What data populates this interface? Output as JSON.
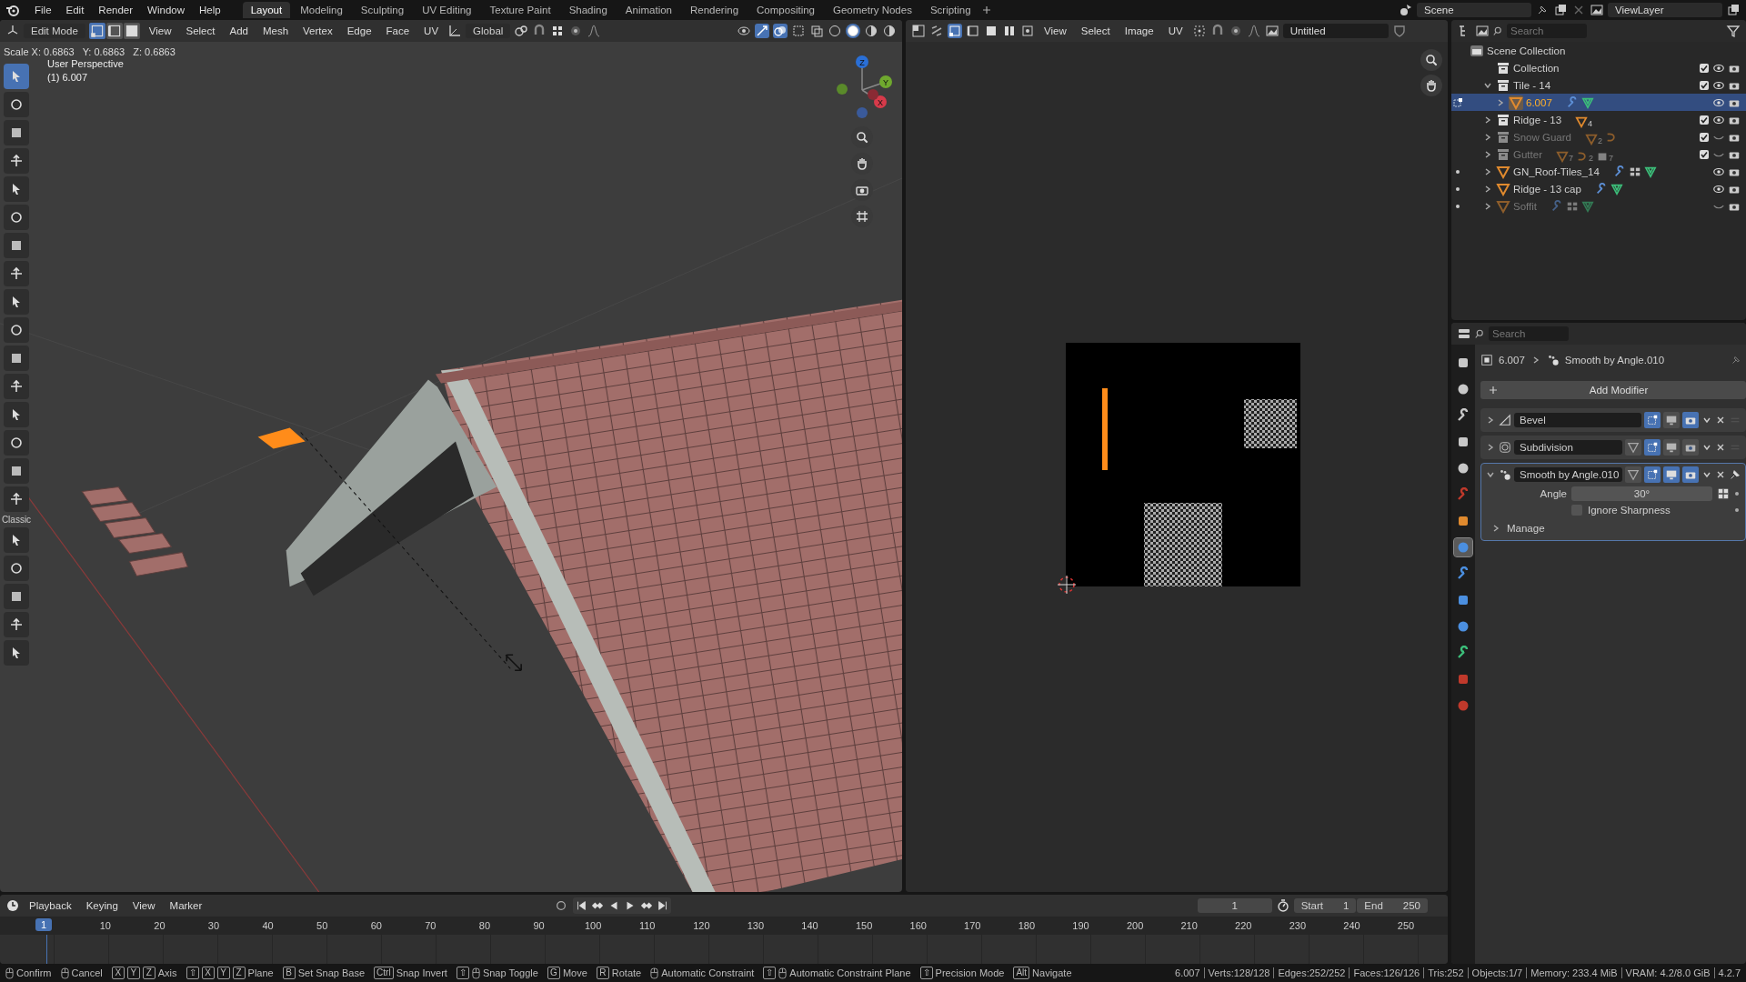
{
  "menu": [
    "File",
    "Edit",
    "Render",
    "Window",
    "Help"
  ],
  "workspaces": [
    {
      "label": "Layout",
      "selected": true
    },
    {
      "label": "Modeling",
      "selected": false
    },
    {
      "label": "Sculpting",
      "selected": false
    },
    {
      "label": "UV Editing",
      "selected": false
    },
    {
      "label": "Texture Paint",
      "selected": false
    },
    {
      "label": "Shading",
      "selected": false
    },
    {
      "label": "Animation",
      "selected": false
    },
    {
      "label": "Rendering",
      "selected": false
    },
    {
      "label": "Compositing",
      "selected": false
    },
    {
      "label": "Geometry Nodes",
      "selected": false
    },
    {
      "label": "Scripting",
      "selected": false
    }
  ],
  "scene": "Scene",
  "view_layer": "ViewLayer",
  "viewport": {
    "mode": "Edit Mode",
    "select_modes": [
      {
        "selected": true
      },
      {
        "selected": false
      },
      {
        "selected": false
      }
    ],
    "menus": [
      "View",
      "Select",
      "Add",
      "Mesh",
      "Vertex",
      "Edge",
      "Face",
      "UV"
    ],
    "orientation": "Global",
    "operator_info": "Scale X: 0.6863   Y: 0.6863   Z: 0.6863",
    "view_name": "User Perspective",
    "object_info": "(1) 6.007",
    "toolbar_label": "Classic",
    "tools": [
      {
        "selected": true
      },
      {
        "selected": false
      },
      {
        "selected": false
      },
      {
        "selected": false
      },
      {
        "selected": false
      },
      {
        "selected": false
      },
      {
        "selected": false
      },
      {
        "selected": false
      },
      {
        "selected": false
      },
      {
        "selected": false
      },
      {
        "selected": false
      },
      {
        "selected": false
      },
      {
        "selected": false
      },
      {
        "selected": false
      },
      {
        "selected": false
      },
      {
        "selected": false
      },
      {
        "selected": false
      },
      {
        "selected": false
      },
      {
        "selected": false
      },
      {
        "selected": false
      },
      {
        "selected": false
      }
    ],
    "gizmo": [
      {
        "label": "Z",
        "color": "#2a6fd6"
      },
      {
        "label": "Y",
        "color": "#6fa82e"
      },
      {
        "label": "X",
        "color": "#d63a4a"
      }
    ]
  },
  "uv_editor": {
    "menus": [
      "View",
      "Select",
      "Image",
      "UV"
    ],
    "image_name": "Untitled"
  },
  "outliner": {
    "search_placeholder": "Search",
    "root": "Scene Collection",
    "items": [
      {
        "kind": "collection",
        "name": "Collection",
        "selected": false,
        "disabled": false,
        "checked": true,
        "visible": true
      },
      {
        "kind": "collection",
        "name": "Tile - 14",
        "expanded": true,
        "selected": false,
        "disabled": false,
        "checked": true,
        "visible": true,
        "children": [
          {
            "kind": "object",
            "name": "6.007",
            "expanded": false,
            "selected": true,
            "disabled": false,
            "visible": true,
            "badges": [
              {
                "kind": "modifier"
              },
              {
                "kind": "mesh"
              }
            ]
          }
        ]
      },
      {
        "kind": "collection",
        "name": "Ridge - 13",
        "expanded": false,
        "selected": false,
        "disabled": false,
        "checked": true,
        "visible": true,
        "badges": [
          {
            "kind": "object",
            "count": "4"
          }
        ]
      },
      {
        "kind": "collection",
        "name": "Snow Guard",
        "expanded": false,
        "selected": false,
        "disabled": true,
        "checked": true,
        "visible": false,
        "badges": [
          {
            "kind": "object",
            "count": "2"
          },
          {
            "kind": "curve"
          }
        ]
      },
      {
        "kind": "collection",
        "name": "Gutter",
        "expanded": false,
        "selected": false,
        "disabled": true,
        "checked": true,
        "visible": false,
        "badges": [
          {
            "kind": "object",
            "count": "7"
          },
          {
            "kind": "curve",
            "count": "2"
          },
          {
            "kind": "collection",
            "count": "7"
          }
        ]
      },
      {
        "kind": "object",
        "name": "GN_Roof-Tiles_14",
        "expanded": false,
        "selected": false,
        "disabled": false,
        "visible": true,
        "badges": [
          {
            "kind": "modifier"
          },
          {
            "kind": "nodes"
          },
          {
            "kind": "mesh"
          }
        ]
      },
      {
        "kind": "object",
        "name": "Ridge - 13 cap",
        "expanded": false,
        "selected": false,
        "disabled": false,
        "visible": true,
        "badges": [
          {
            "kind": "modifier"
          },
          {
            "kind": "mesh"
          }
        ]
      },
      {
        "kind": "object",
        "name": "Soffit",
        "expanded": false,
        "selected": false,
        "disabled": true,
        "visible": false,
        "badges": [
          {
            "kind": "modifier"
          },
          {
            "kind": "nodes"
          },
          {
            "kind": "mesh"
          }
        ]
      }
    ]
  },
  "properties": {
    "search_placeholder": "Search",
    "tabs": [
      {
        "color": "#c8c8c8",
        "selected": false
      },
      {
        "color": "#c8c8c8",
        "selected": false
      },
      {
        "color": "#c8c8c8",
        "selected": false
      },
      {
        "color": "#c8c8c8",
        "selected": false
      },
      {
        "color": "#c8c8c8",
        "selected": false
      },
      {
        "color": "#c0392b",
        "selected": false
      },
      {
        "color": "#e08a2e",
        "selected": false
      },
      {
        "color": "#4b8fe0",
        "selected": true
      },
      {
        "color": "#4b8fe0",
        "selected": false
      },
      {
        "color": "#4b8fe0",
        "selected": false
      },
      {
        "color": "#4b8fe0",
        "selected": false
      },
      {
        "color": "#3cbf7a",
        "selected": false
      },
      {
        "color": "#c0392b",
        "selected": false
      },
      {
        "color": "#c0392b",
        "selected": false
      }
    ],
    "breadcrumb": [
      "6.007",
      "Smooth by Angle.010"
    ],
    "add_button": "Add Modifier",
    "modifiers": [
      {
        "name": "Bevel",
        "expanded": false,
        "active": false,
        "toggles": [
          {
            "kind": "editmode",
            "on": true
          },
          {
            "kind": "viewport",
            "on": false
          },
          {
            "kind": "render",
            "on": true
          }
        ]
      },
      {
        "name": "Subdivision",
        "expanded": false,
        "active": false,
        "toggles": [
          {
            "kind": "cage",
            "on": false
          },
          {
            "kind": "editmode",
            "on": true
          },
          {
            "kind": "viewport",
            "on": false
          },
          {
            "kind": "render",
            "on": false
          }
        ]
      },
      {
        "name": "Smooth by Angle.010",
        "expanded": true,
        "active": true,
        "toggles": [
          {
            "kind": "cage",
            "on": false
          },
          {
            "kind": "editmode",
            "on": true
          },
          {
            "kind": "viewport",
            "on": true
          },
          {
            "kind": "render",
            "on": true
          }
        ],
        "angle_label": "Angle",
        "angle_value": "30°",
        "option_label": "Ignore Sharpness",
        "option_checked": false,
        "subpanel": "Manage"
      }
    ]
  },
  "timeline": {
    "menus": [
      "Playback",
      "Keying",
      "View",
      "Marker"
    ],
    "current_frame": "1",
    "start_label": "Start",
    "start": "1",
    "end_label": "End",
    "end": "250",
    "playhead": "1",
    "ticks": [
      "10",
      "20",
      "30",
      "40",
      "50",
      "60",
      "70",
      "80",
      "90",
      "100",
      "110",
      "120",
      "130",
      "140",
      "150",
      "160",
      "170",
      "180",
      "190",
      "200",
      "210",
      "220",
      "230",
      "240",
      "250"
    ]
  },
  "status_hints": [
    {
      "mouse": true,
      "label": "Confirm"
    },
    {
      "mouse": true,
      "label": "Cancel"
    },
    {
      "keys": [
        "X",
        "Y",
        "Z"
      ],
      "label": "Axis"
    },
    {
      "keys": [
        "⇧",
        "X",
        "Y",
        "Z"
      ],
      "label": "Plane"
    },
    {
      "keys": [
        "B"
      ],
      "label": "Set Snap Base"
    },
    {
      "keys": [
        "Ctrl"
      ],
      "label": "Snap Invert"
    },
    {
      "keys": [
        "⇧"
      ],
      "mouse": true,
      "label": "Snap Toggle"
    },
    {
      "keys": [
        "G"
      ],
      "label": "Move"
    },
    {
      "keys": [
        "R"
      ],
      "label": "Rotate"
    },
    {
      "mouse": true,
      "label": "Automatic Constraint"
    },
    {
      "keys": [
        "⇧"
      ],
      "mouse": true,
      "label": "Automatic Constraint Plane"
    },
    {
      "keys": [
        "⇧"
      ],
      "label": "Precision Mode"
    },
    {
      "keys": [
        "Alt"
      ],
      "label": "Navigate"
    }
  ],
  "status_stats": [
    "6.007",
    "Verts:128/128",
    "Edges:252/252",
    "Faces:126/126",
    "Tris:252",
    "Objects:1/7",
    "Memory: 233.4 MiB",
    "VRAM: 4.2/8.0 GiB",
    "4.2.7"
  ]
}
